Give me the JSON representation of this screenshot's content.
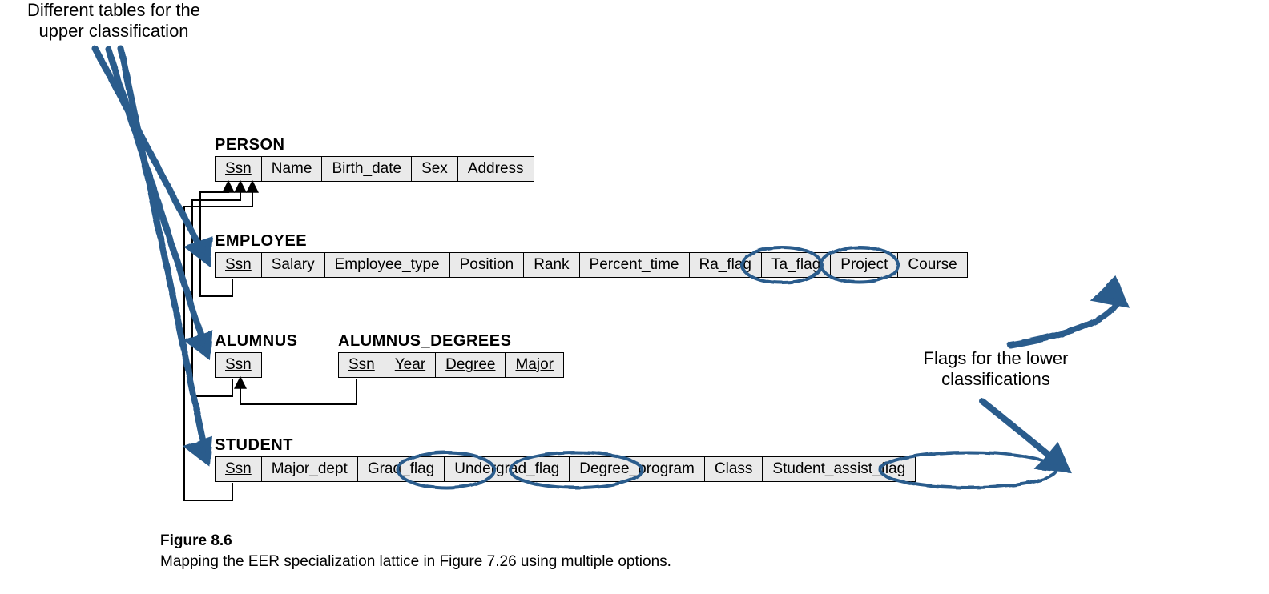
{
  "annotations": {
    "upper": "Different tables for the upper classification",
    "lower": "Flags for the lower classifications"
  },
  "tables": {
    "person": {
      "title": "PERSON",
      "cols": [
        "Ssn",
        "Name",
        "Birth_date",
        "Sex",
        "Address"
      ],
      "underline": [
        0
      ]
    },
    "employee": {
      "title": "EMPLOYEE",
      "cols": [
        "Ssn",
        "Salary",
        "Employee_type",
        "Position",
        "Rank",
        "Percent_time",
        "Ra_flag",
        "Ta_flag",
        "Project",
        "Course"
      ],
      "underline": [
        0
      ]
    },
    "alumnus": {
      "title": "ALUMNUS",
      "cols": [
        "Ssn"
      ],
      "underline": [
        0
      ]
    },
    "alumnus_degrees": {
      "title": "ALUMNUS_DEGREES",
      "cols": [
        "Ssn",
        "Year",
        "Degree",
        "Major"
      ],
      "underline": [
        0,
        1,
        2,
        3
      ]
    },
    "student": {
      "title": "STUDENT",
      "cols": [
        "Ssn",
        "Major_dept",
        "Grad_flag",
        "Undergrad_flag",
        "Degree_program",
        "Class",
        "Student_assist_flag"
      ],
      "underline": [
        0
      ]
    }
  },
  "caption": {
    "title": "Figure 8.6",
    "text": "Mapping the EER specialization lattice in Figure 7.26 using multiple options."
  },
  "style": {
    "circle_color": "#2a5b8c",
    "hand_color": "#2a5b8c",
    "schema_line": "#000000"
  }
}
